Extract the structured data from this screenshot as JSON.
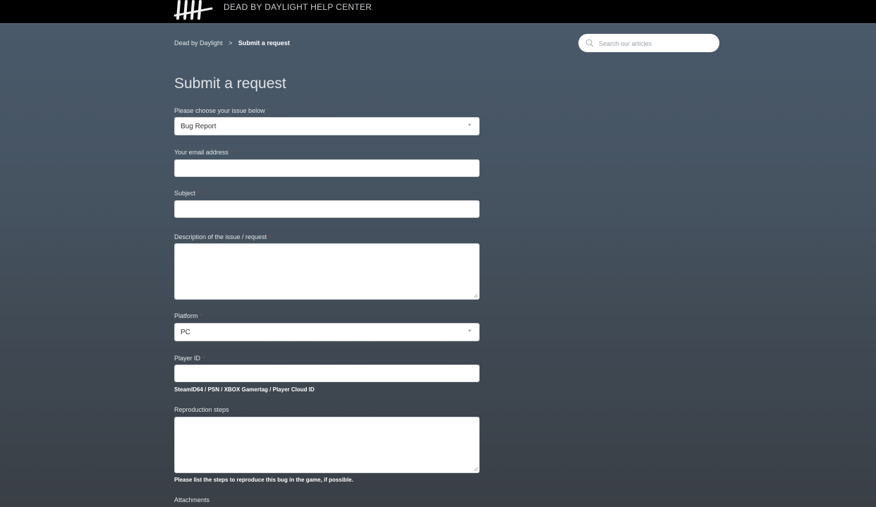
{
  "header": {
    "site_title": "DEAD BY DAYLIGHT HELP CENTER"
  },
  "breadcrumb": {
    "root": "Dead by Daylight",
    "separator": ">",
    "current": "Submit a request"
  },
  "search": {
    "placeholder": "Search our articles"
  },
  "page": {
    "title": "Submit a request"
  },
  "form": {
    "issue": {
      "label": "Please choose your issue below",
      "value": "Bug Report"
    },
    "email": {
      "label": "Your email address",
      "required_mark": "*",
      "value": ""
    },
    "subject": {
      "label": "Subject",
      "required_mark": "*",
      "value": ""
    },
    "description": {
      "label": "Description of the issue / request",
      "required_mark": "*",
      "value": ""
    },
    "platform": {
      "label": "Platform",
      "required_mark": "*",
      "value": "PC"
    },
    "player_id": {
      "label": "Player ID",
      "required_mark": "*",
      "value": "",
      "hint": "SteamID64 / PSN / XBOX Gamertag / Player Cloud ID"
    },
    "repro": {
      "label": "Reproduction steps",
      "value": "",
      "hint": "Please list the steps to reproduce this bug in the game, if possible."
    },
    "attachments": {
      "label": "Attachments"
    }
  },
  "colors": {
    "topbar": "#000000",
    "background_top": "#4a5a6b",
    "background_bottom": "#3a3f46",
    "required": "#8e4b4b"
  }
}
